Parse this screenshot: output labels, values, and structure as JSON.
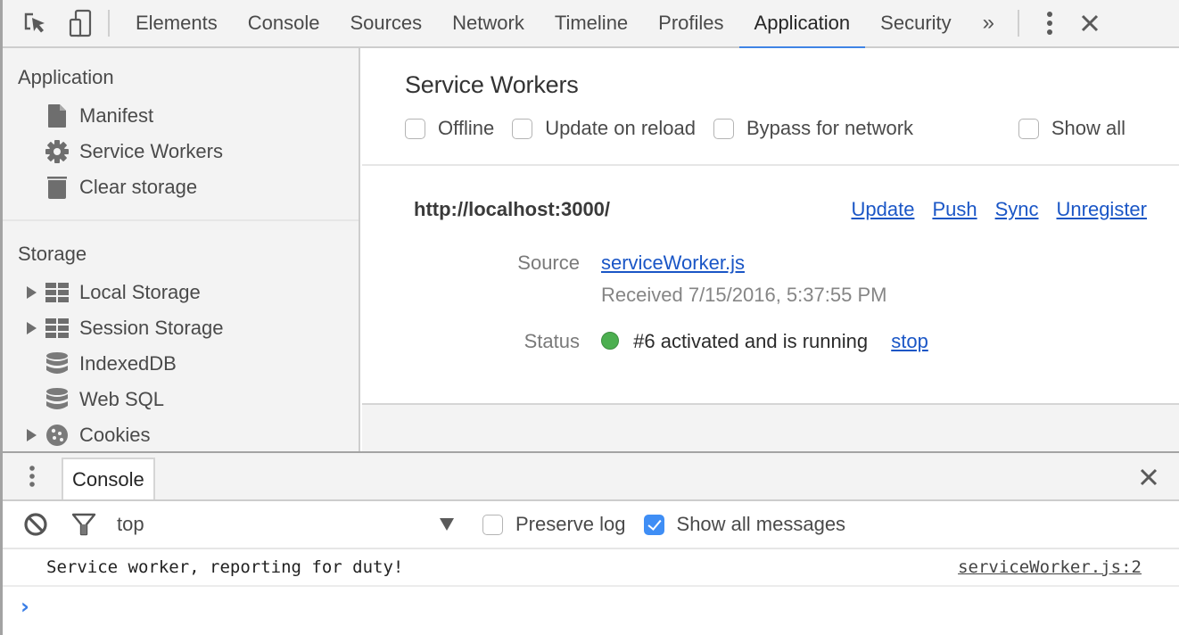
{
  "toolbar": {
    "tabs": [
      {
        "label": "Elements",
        "active": false
      },
      {
        "label": "Console",
        "active": false
      },
      {
        "label": "Sources",
        "active": false
      },
      {
        "label": "Network",
        "active": false
      },
      {
        "label": "Timeline",
        "active": false
      },
      {
        "label": "Profiles",
        "active": false
      },
      {
        "label": "Application",
        "active": true
      },
      {
        "label": "Security",
        "active": false
      }
    ],
    "overflow_label": "»",
    "accent_color": "#3f84e5"
  },
  "sidebar": {
    "application": {
      "heading": "Application",
      "items": [
        {
          "label": "Manifest",
          "icon": "document-icon"
        },
        {
          "label": "Service Workers",
          "icon": "gear-icon"
        },
        {
          "label": "Clear storage",
          "icon": "trash-icon"
        }
      ]
    },
    "storage": {
      "heading": "Storage",
      "items": [
        {
          "label": "Local Storage",
          "icon": "grid-icon",
          "expandable": true
        },
        {
          "label": "Session Storage",
          "icon": "grid-icon",
          "expandable": true
        },
        {
          "label": "IndexedDB",
          "icon": "database-icon",
          "expandable": false
        },
        {
          "label": "Web SQL",
          "icon": "database-icon",
          "expandable": false
        },
        {
          "label": "Cookies",
          "icon": "cookie-icon",
          "expandable": true
        }
      ]
    }
  },
  "main": {
    "title": "Service Workers",
    "options": [
      {
        "label": "Offline",
        "checked": false
      },
      {
        "label": "Update on reload",
        "checked": false
      },
      {
        "label": "Bypass for network",
        "checked": false
      },
      {
        "label": "Show all",
        "checked": false
      }
    ],
    "worker": {
      "origin": "http://localhost:3000/",
      "actions": [
        "Update",
        "Push",
        "Sync",
        "Unregister"
      ],
      "source_label": "Source",
      "source_file": "serviceWorker.js",
      "received": "Received 7/15/2016, 5:37:55 PM",
      "status_label": "Status",
      "status_text": "#6 activated and is running",
      "status_color": "#4caf50",
      "stop_label": "stop"
    }
  },
  "drawer": {
    "tab_label": "Console",
    "context": "top",
    "preserve_log": {
      "label": "Preserve log",
      "checked": false
    },
    "show_all_messages": {
      "label": "Show all messages",
      "checked": true
    },
    "messages": [
      {
        "text": "Service worker, reporting for duty!",
        "source": "serviceWorker.js:2"
      }
    ],
    "prompt_symbol": "›"
  }
}
